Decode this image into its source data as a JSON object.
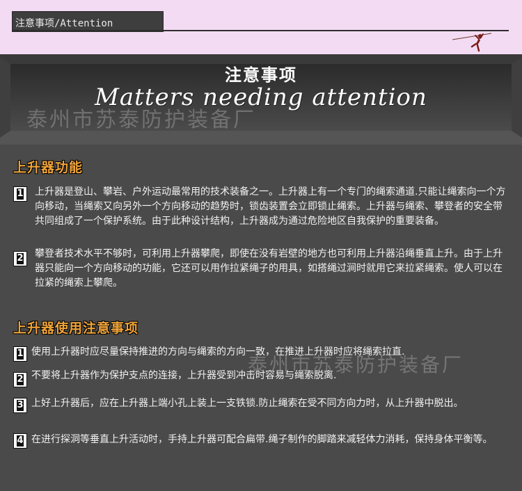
{
  "header": {
    "tab_title": "注意事项/Attention",
    "climber_icon": "climber-icon"
  },
  "banner": {
    "title_cn": "注意事项",
    "title_en": "Matters needing attention",
    "watermark": "泰州市苏泰防护装备厂"
  },
  "section1": {
    "heading": "上升器功能",
    "items": [
      {
        "num": "1",
        "text": "上升器是登山、攀岩、户外运动最常用的技术装备之一。上升器上有一个专门的绳索通道.只能让绳索向一个方向移动，当绳索又向另外一个方向移动的趋势时，锁齿装置会立即锁止绳索。上升器与绳索、攀登者的安全带共同组成了一个保护系统。由于此种设计结构，上升器成为通过危险地区自我保护的重要装备。"
      },
      {
        "num": "2",
        "text": "攀登者技术水平不够时，可利用上升器攀爬，即使在没有岩壁的地方也可利用上升器沿绳垂直上升。由于上升器只能向一个方向移动的功能，它还可以用作拉紧绳子的用具，如搭绳过涧时就用它来拉紧绳索。使人可以在拉紧的绳索上攀爬。"
      }
    ]
  },
  "section2": {
    "heading": "上升器使用注意事项",
    "watermark": "泰州市苏泰防护装备厂",
    "items": [
      {
        "num": "1",
        "text": "使用上升器时应尽量保持推进的方向与绳索的方向一致，在推进上升器时应将绳索拉直."
      },
      {
        "num": "2",
        "text": "不要将上升器作为保护支点的连接，上升器受到冲击时容易与绳索脱离."
      },
      {
        "num": "3",
        "text": "上好上升器后，应在上升器上端小孔上装上一支铁锁.防止绳索在受不同方向力时，从上升器中脱出。"
      },
      {
        "num": "4",
        "text": "在进行探洞等垂直上升活动时，手持上升器可配合扁带.绳子制作的脚踏来减轻体力消耗，保持身体平衡等。"
      }
    ]
  },
  "colors": {
    "header_bg": "#f3dcf3",
    "body_bg": "#4a4a4a",
    "heading_orange": "#f0a43a",
    "text": "#f2f2f2"
  }
}
